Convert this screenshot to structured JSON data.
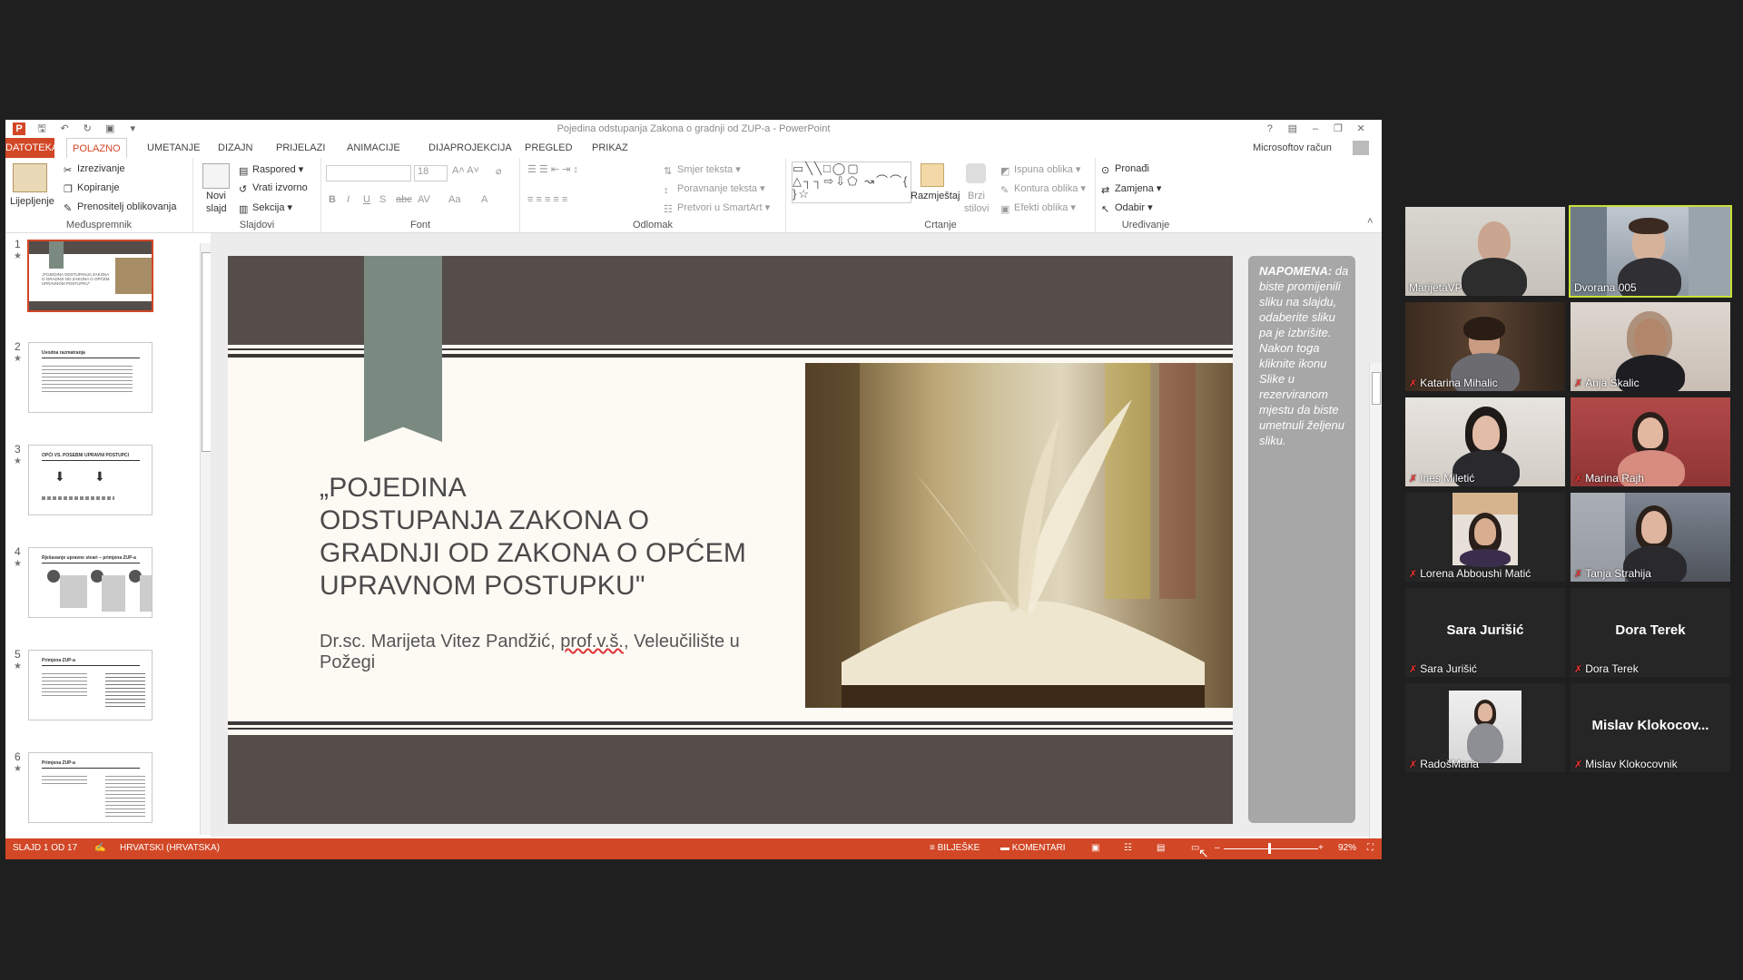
{
  "window": {
    "title": "Pojedina odstupanja Zakona o gradnji od ZUP-a - PowerPoint",
    "account": "Microsoftov račun",
    "help": "?"
  },
  "tabs": [
    {
      "label": "DATOTEKA"
    },
    {
      "label": "POLAZNO"
    },
    {
      "label": "UMETANJE"
    },
    {
      "label": "DIZAJN"
    },
    {
      "label": "PRIJELAZI"
    },
    {
      "label": "ANIMACIJE"
    },
    {
      "label": "DIJAPROJEKCIJA"
    },
    {
      "label": "PREGLED"
    },
    {
      "label": "PRIKAZ"
    }
  ],
  "ribbon": {
    "clipboard": {
      "group": "Međuspremnik",
      "paste": "Lijepljenje",
      "cut": "Izrezivanje",
      "copy": "Kopiranje",
      "format_painter": "Prenositelj oblikovanja"
    },
    "slides": {
      "group": "Slajdovi",
      "new_slide_1": "Novi",
      "new_slide_2": "slajd",
      "layout": "Raspored",
      "reset": "Vrati izvorno",
      "section": "Sekcija"
    },
    "font": {
      "group": "Font",
      "size": "18",
      "bold": "B",
      "italic": "I",
      "underline": "U",
      "shadow": "S",
      "strike": "abc",
      "spacing": "AV",
      "case": "Aa",
      "color": "A"
    },
    "paragraph": {
      "group": "Odlomak",
      "text_direction": "Smjer teksta",
      "align_text": "Poravnanje teksta",
      "smartart": "Pretvori u SmartArt"
    },
    "drawing": {
      "group": "Crtanje",
      "arrange": "Razmještaj",
      "quick_styles_1": "Brzi",
      "quick_styles_2": "stilovi",
      "fill": "Ispuna oblika",
      "outline": "Kontura oblika",
      "effects": "Efekti oblika"
    },
    "editing": {
      "group": "Uređivanje",
      "find": "Pronađi",
      "replace": "Zamjena",
      "select": "Odabir"
    }
  },
  "thumbnails": [
    {
      "num": "1",
      "title": "„POJEDINA ODSTUPANJA ZAKONA O GRADNJI OD ZAKONA O OPĆEM UPRAVNOM POSTUPKU\""
    },
    {
      "num": "2",
      "title": "Uvodna razmatranja"
    },
    {
      "num": "3",
      "title": "OPĆI VS. POSEBNI UPRAVNI POSTUPCI"
    },
    {
      "num": "4",
      "title": "Rješavanje upravne stvari – primjena ZUP-a"
    },
    {
      "num": "5",
      "title": "Primjena ZUP-a"
    },
    {
      "num": "6",
      "title": "Primjena ZUP-a"
    }
  ],
  "slide": {
    "title_lines": [
      "„POJEDINA",
      "ODSTUPANJA ZAKONA O",
      "GRADNJI OD ZAKONA O OPĆEM",
      "UPRAVNOM POSTUPKU\""
    ],
    "subtitle_a": "Dr.sc. Marijeta Vitez Pandžić, ",
    "subtitle_b": "prof.v.š.",
    "subtitle_c": ", Veleučilište u Požegi"
  },
  "note": {
    "heading": "NAPOMENA:",
    "body": "da biste promijenili sliku na slajdu, odaberite sliku pa je izbrišite. Nakon toga kliknite ikonu Slike u rezerviranom mjestu da biste umetnuli željenu sliku."
  },
  "statusbar": {
    "slide_counter": "SLAJD 1 OD 17",
    "language": "HRVATSKI (HRVATSKA)",
    "notes": "BILJEŠKE",
    "comments": "KOMENTARI",
    "zoom": "92%"
  },
  "participants": [
    {
      "name": "MarijetaVP",
      "muted": false,
      "video": true,
      "speaking": false
    },
    {
      "name": "Dvorana 005",
      "muted": false,
      "video": true,
      "speaking": true
    },
    {
      "name": "Katarina Mihalic",
      "muted": true,
      "video": true,
      "speaking": false
    },
    {
      "name": "Anja Škalic",
      "muted": true,
      "video": true,
      "speaking": false
    },
    {
      "name": "Ines Miletić",
      "muted": true,
      "video": true,
      "speaking": false
    },
    {
      "name": "Marina Rajh",
      "muted": true,
      "video": true,
      "speaking": false
    },
    {
      "name": "Lorena Abboushi Matić",
      "muted": true,
      "video": true,
      "speaking": false
    },
    {
      "name": "Tanja Strahija",
      "muted": true,
      "video": true,
      "speaking": false
    },
    {
      "name": "Sara Jurišić",
      "muted": true,
      "video": false,
      "speaking": false,
      "display": "Sara Jurišić"
    },
    {
      "name": "Dora Terek",
      "muted": true,
      "video": false,
      "speaking": false,
      "display": "Dora Terek"
    },
    {
      "name": "RadošMaria",
      "muted": true,
      "video": true,
      "speaking": false
    },
    {
      "name": "Mislav Klokocovnik",
      "muted": true,
      "video": false,
      "speaking": false,
      "display": "Mislav  Klokocov..."
    }
  ],
  "colors": {
    "accent": "#d24726",
    "speaking": "#c8e03a",
    "slide_band": "#554d4a",
    "note_bg": "#a7a7a7"
  }
}
